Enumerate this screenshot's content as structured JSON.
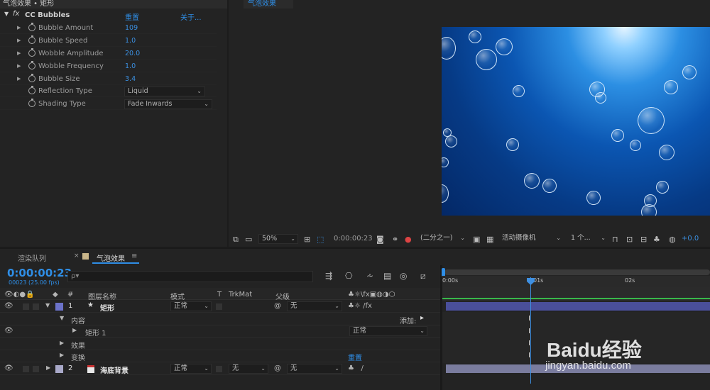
{
  "effect_controls": {
    "header": "气泡效果 • 矩形",
    "effect_name": "CC Bubbles",
    "reset_label": "重置",
    "about_label": "关于...",
    "params": [
      {
        "name": "Bubble Amount",
        "value": "109"
      },
      {
        "name": "Bubble Speed",
        "value": "1.0"
      },
      {
        "name": "Wobble Amplitude",
        "value": "20.0"
      },
      {
        "name": "Wobble Frequency",
        "value": "1.0"
      },
      {
        "name": "Bubble Size",
        "value": "3.4"
      },
      {
        "name": "Reflection Type",
        "value": "Liquid"
      },
      {
        "name": "Shading Type",
        "value": "Fade Inwards"
      }
    ]
  },
  "composition": {
    "tab": "气泡效果",
    "toolbar": {
      "zoom": "50%",
      "timecode": "0:00:00:23",
      "resolution": "(二分之一)",
      "camera": "活动摄像机",
      "views": "1 个...",
      "exposure": "+0.0"
    }
  },
  "timeline": {
    "tabs": [
      "渲染队列",
      "气泡效果"
    ],
    "timecode": "0:00:00:23",
    "timecode_sub": "00023 (25.00 fps)",
    "search_placeholder": "ρ▾",
    "columns": {
      "num": "#",
      "name": "图层名称",
      "mode": "模式",
      "t": "T",
      "trkmat": "TrkMat",
      "parent": "父级"
    },
    "rows": {
      "layer1": {
        "num": "1",
        "name": "矩形",
        "mode": "正常",
        "parent": "无"
      },
      "contents": "内容",
      "add_label": "添加:",
      "shape": "矩形 1",
      "shape_mode": "正常",
      "effects": "效果",
      "transform": "变换",
      "transform_reset": "重置",
      "layer2": {
        "num": "2",
        "name": "海底背景",
        "mode": "正常",
        "trkmat": "无",
        "parent": "无"
      }
    },
    "ruler": [
      "0:00s",
      "01s",
      "02s"
    ],
    "watermark": {
      "brand": "Baidu经验",
      "url": "jingyan.baidu.com"
    }
  },
  "colors": {
    "accent": "#2f8ee6",
    "layer1_track": "#4a4f9a",
    "layer2_track": "#7a7c9e"
  }
}
